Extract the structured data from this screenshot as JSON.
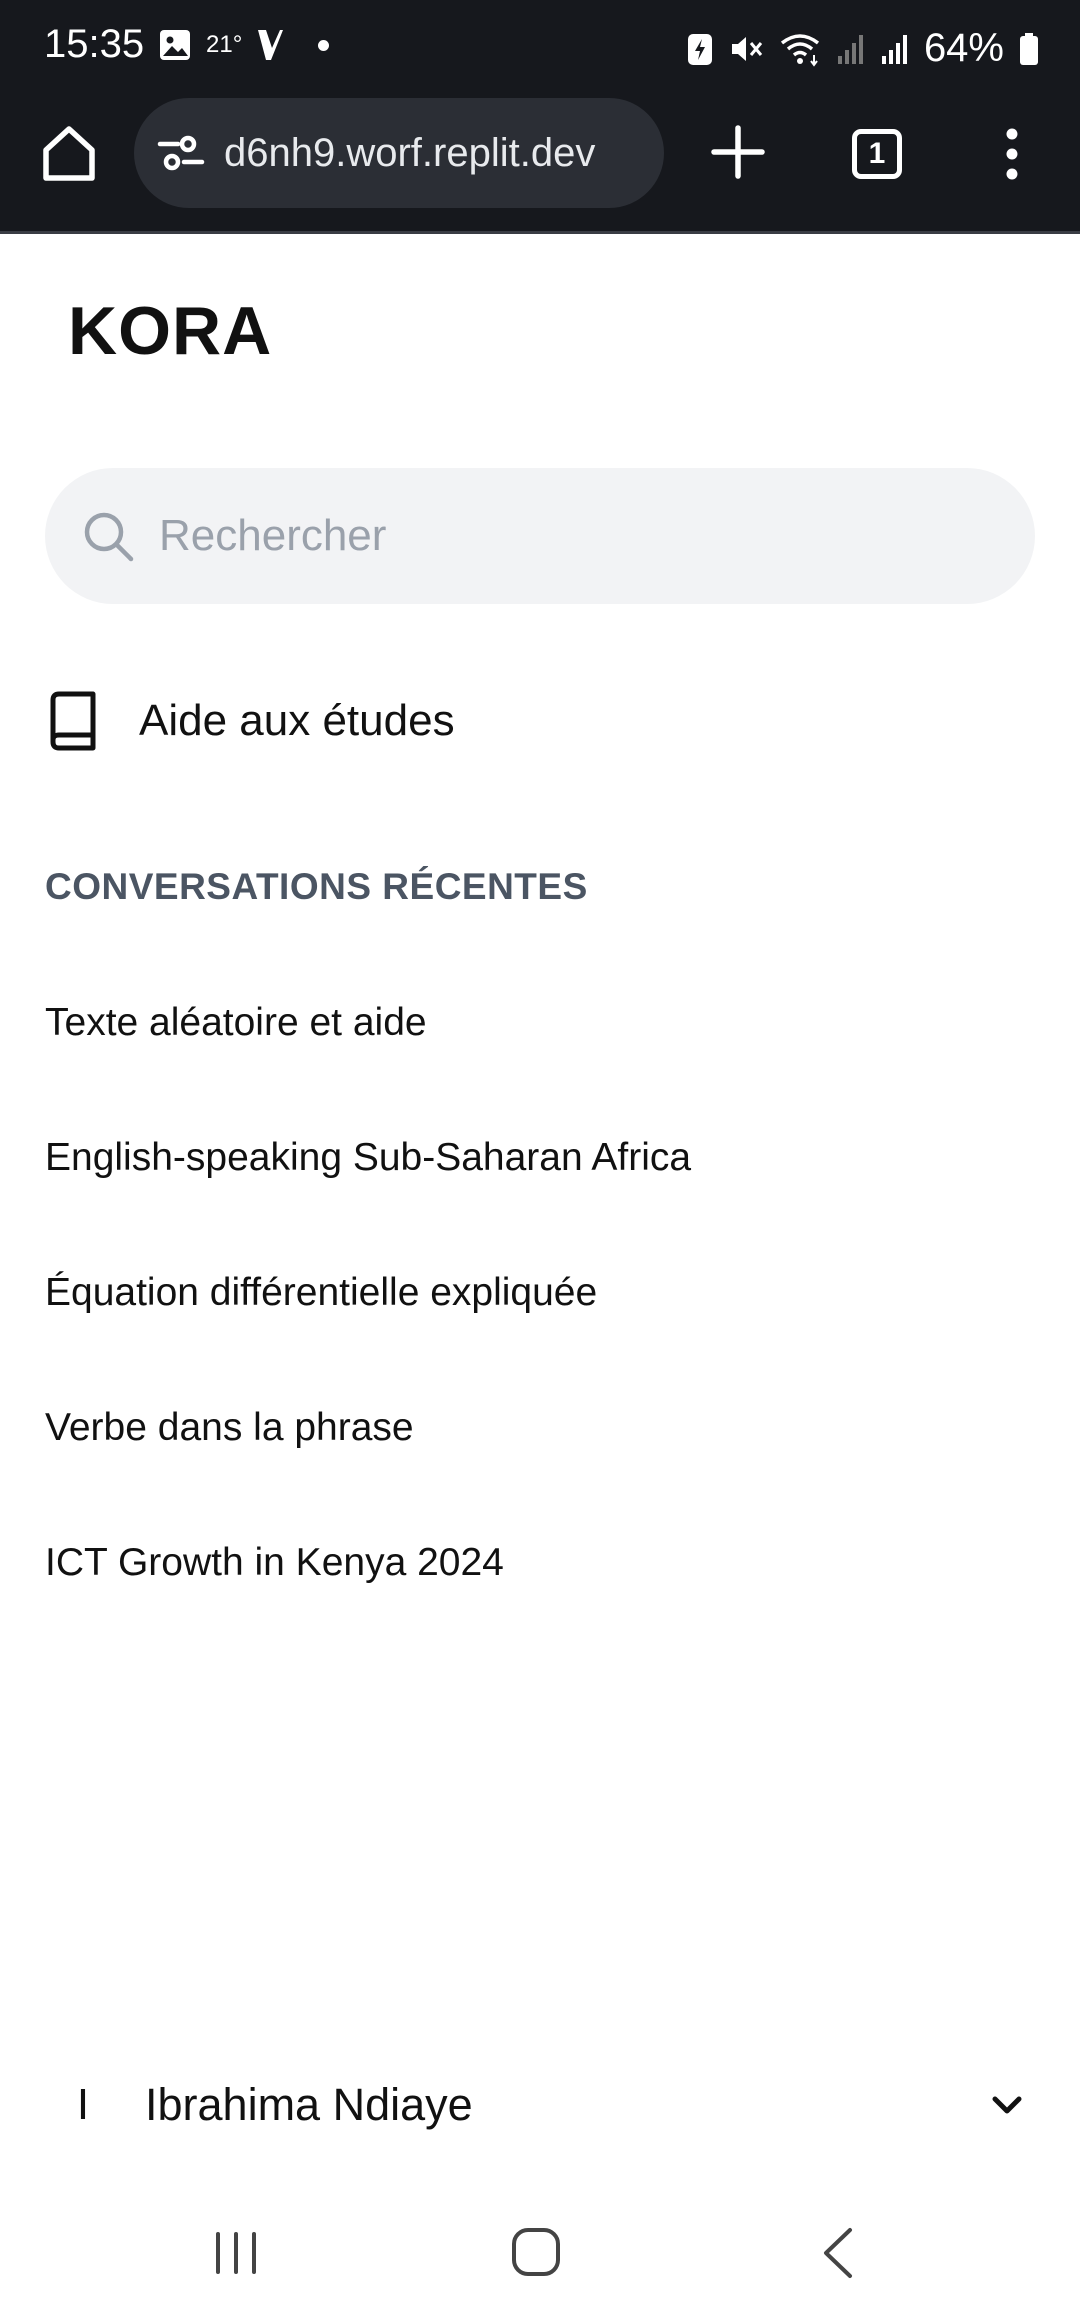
{
  "status_bar": {
    "time": "15:35",
    "temperature": "21°",
    "battery_percent": "64%"
  },
  "browser": {
    "url": "d6nh9.worf.replit.dev",
    "tab_count": "1"
  },
  "app": {
    "title": "KORA"
  },
  "search": {
    "placeholder": "Rechercher",
    "value": ""
  },
  "nav": {
    "study_help_label": "Aide aux études"
  },
  "recent": {
    "heading": "CONVERSATIONS RÉCENTES",
    "items": [
      "Texte aléatoire et aide",
      "English-speaking Sub-Saharan Africa",
      "Équation différentielle expliquée",
      "Verbe dans la phrase",
      "ICT Growth in Kenya 2024"
    ]
  },
  "user": {
    "initial": "I",
    "name": "Ibrahima Ndiaye"
  },
  "colors": {
    "chrome_bg": "#16181d",
    "search_bg": "#f2f3f5",
    "heading_gray": "#4b5563"
  }
}
